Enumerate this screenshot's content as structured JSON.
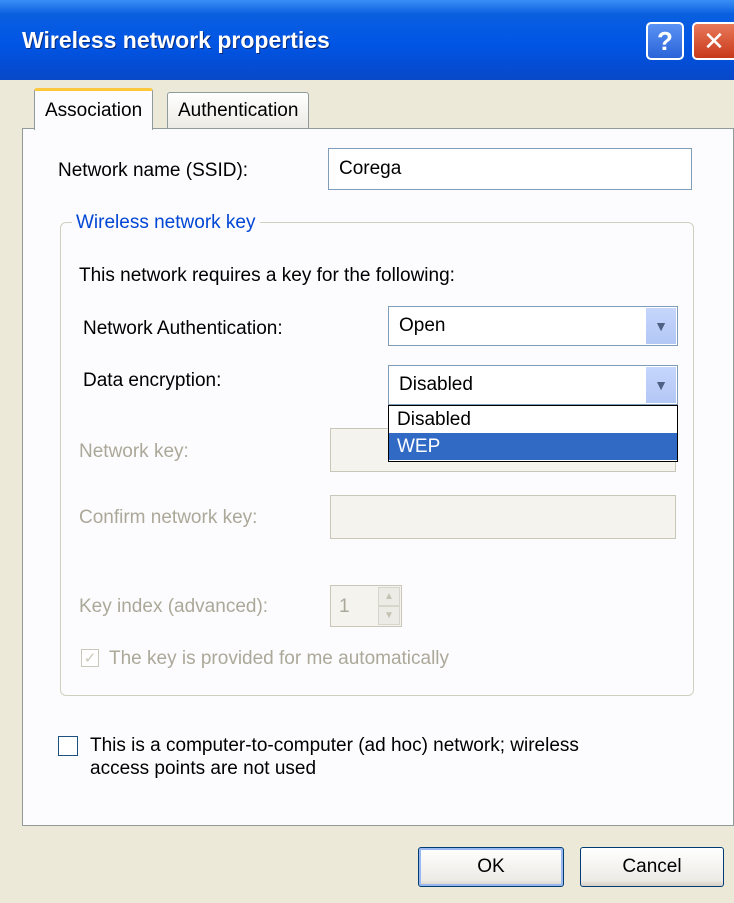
{
  "window": {
    "title": "Wireless network properties",
    "help_label": "?",
    "close_label": "✕"
  },
  "tabs": [
    {
      "label": "Association",
      "active": true
    },
    {
      "label": "Authentication",
      "active": false
    }
  ],
  "ssid": {
    "label": "Network name (SSID):",
    "value": "Corega"
  },
  "key_group": {
    "legend": "Wireless network key",
    "intro": "This network requires a key for the following:",
    "auth": {
      "label": "Network Authentication:",
      "value": "Open"
    },
    "encryption": {
      "label": "Data encryption:",
      "value": "Disabled",
      "options": [
        "Disabled",
        "WEP"
      ],
      "highlighted": "WEP"
    },
    "network_key": {
      "label": "Network key:",
      "value": ""
    },
    "confirm_key": {
      "label": "Confirm network key:",
      "value": ""
    },
    "key_index": {
      "label": "Key index (advanced):",
      "value": "1"
    },
    "auto_key": {
      "label": "The key is provided for me automatically",
      "checked": true
    }
  },
  "adhoc": {
    "label_line1": "This is a computer-to-computer (ad hoc) network; wireless",
    "label_line2": "access points are not used",
    "checked": false
  },
  "buttons": {
    "ok": "OK",
    "cancel": "Cancel"
  },
  "colors": {
    "titlebar": "#0055e5",
    "selection": "#316ac5",
    "legend": "#0046d5"
  },
  "icons": {
    "help": "help-icon",
    "close": "close-icon",
    "dropdown": "chevron-down-icon",
    "spin_up": "spin-up-icon",
    "spin_down": "spin-down-icon"
  }
}
